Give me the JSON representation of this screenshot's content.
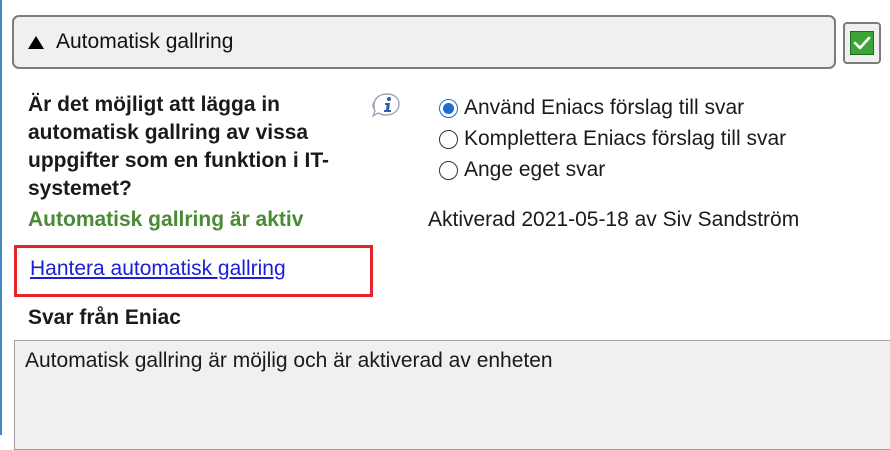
{
  "section": {
    "title": "Automatisk gallring",
    "collapse_icon": "triangle-up-icon",
    "done_checkbox": {
      "checked": true,
      "icon": "check-icon",
      "color": "#3ca336"
    }
  },
  "question": {
    "text": "Är det möjligt att lägga in automatisk gallring av vissa uppgifter som en funktion i IT-systemet?",
    "info_icon": "info-icon"
  },
  "options": [
    {
      "label": "Använd Eniacs förslag till svar",
      "selected": true
    },
    {
      "label": "Komplettera Eniacs förslag till svar",
      "selected": false
    },
    {
      "label": "Ange eget svar",
      "selected": false
    }
  ],
  "status": {
    "text": "Automatisk gallring är aktiv",
    "color": "#4a8a35",
    "activated_text": "Aktiverad 2021-05-18 av Siv Sandström"
  },
  "manage_link": {
    "label": "Hantera automatisk gallring",
    "highlight_color": "#e3242b"
  },
  "answer": {
    "title": "Svar från Eniac",
    "text": "Automatisk gallring är möjlig och är aktiverad av enheten"
  }
}
